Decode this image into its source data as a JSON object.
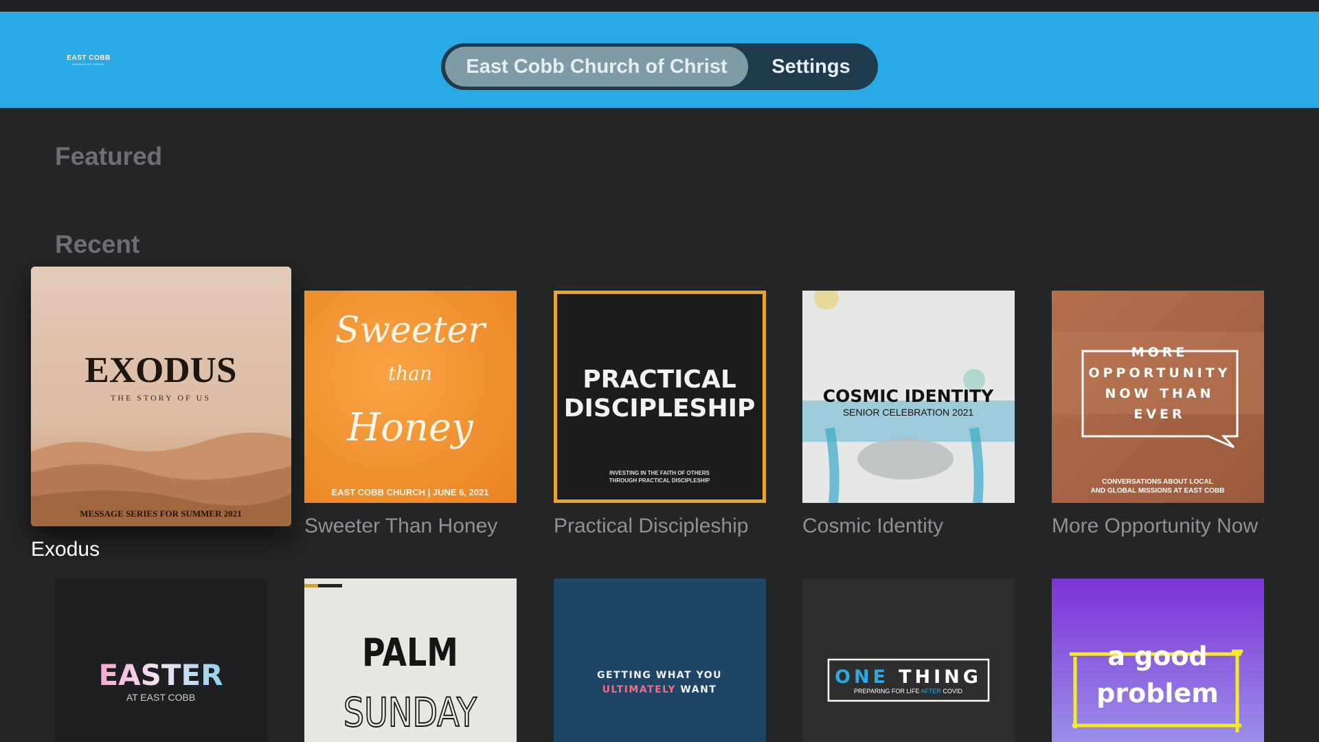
{
  "app": {
    "logo": {
      "line1": "EAST COBB",
      "line2": "CHURCH OF CHRIST"
    },
    "tabs": [
      {
        "label": "East Cobb Church of Christ",
        "selected": true
      },
      {
        "label": "Settings",
        "selected": false
      }
    ]
  },
  "sections": {
    "featured": "Featured",
    "recent": "Recent"
  },
  "recent_items": [
    {
      "title": "Exodus",
      "focused": true,
      "art": {
        "headline": "EXODUS",
        "sub": "THE STORY OF US",
        "footer": "MESSAGE SERIES FOR SUMMER 2021"
      }
    },
    {
      "title": "Sweeter Than Honey",
      "art": {
        "w1": "Sweeter",
        "w2": "than",
        "w3": "Honey",
        "footer": "EAST COBB CHURCH | JUNE 6, 2021"
      }
    },
    {
      "title": "Practical Discipleship",
      "art": {
        "l1": "PRACTICAL",
        "l2": "DISCIPLESHIP",
        "f1": "INVESTING IN THE FAITH OF OTHERS",
        "f2": "THROUGH PRACTICAL DISCIPLESHIP"
      }
    },
    {
      "title": "Cosmic Identity",
      "art": {
        "headline": "COSMIC IDENTITY",
        "sub": "SENIOR CELEBRATION 2021"
      }
    },
    {
      "title": "More Opportunity Now Than Ever",
      "art": {
        "l1": "MORE",
        "l2": "OPPORTUNITY",
        "l3": "NOW THAN",
        "l4": "EVER",
        "f1": "CONVERSATIONS ABOUT LOCAL",
        "f2": "AND GLOBAL MISSIONS AT EAST COBB"
      }
    }
  ],
  "row2_items": [
    {
      "art": {
        "headline": "EASTER",
        "sub": "AT EAST COBB"
      }
    },
    {
      "art": {
        "l1": "PALM",
        "l2": "SUNDAY"
      }
    },
    {
      "art": {
        "l1": "GETTING WHAT YOU",
        "l2a": "ULTIMATELY",
        "l2b": " WANT"
      }
    },
    {
      "art": {
        "w1": "ONE",
        "w2": "THING",
        "s1": "PREPARING FOR LIFE ",
        "s2": "AFTER",
        "s3": " COVID"
      }
    },
    {
      "art": {
        "l1": "a good",
        "l2": "problem"
      }
    }
  ]
}
